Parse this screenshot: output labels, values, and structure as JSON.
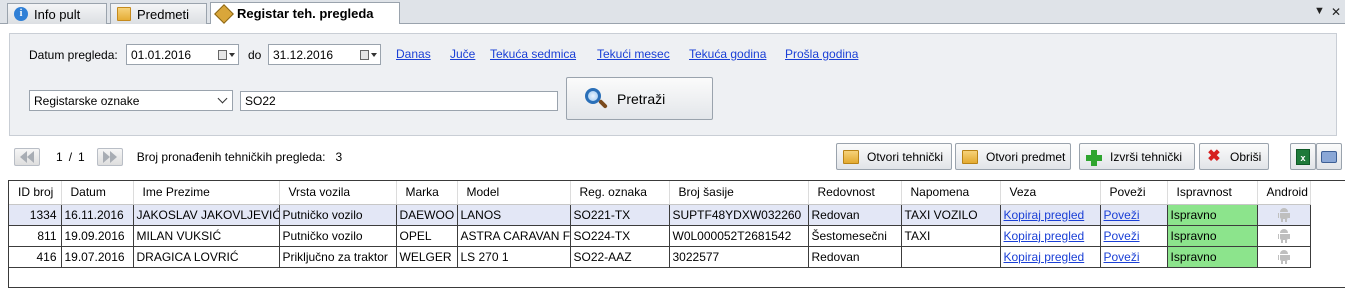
{
  "tabs": [
    {
      "label": "Info pult",
      "icon": "info-icon"
    },
    {
      "label": "Predmeti",
      "icon": "folder-icon"
    },
    {
      "label": "Registar teh. pregleda",
      "icon": "wrench-icon",
      "active": true
    }
  ],
  "filters": {
    "date_label": "Datum pregleda:",
    "date_from": "01.01.2016",
    "to_label": "do",
    "date_to": "31.12.2016",
    "quick_links": [
      "Danas",
      "Juče",
      "Tekuća sedmica",
      "Tekući mesec",
      "Tekuća godina",
      "Prošla godina"
    ],
    "search_field": "Registarske oznake",
    "search_value": "SO22",
    "search_button": "Pretraži"
  },
  "pager": {
    "current": "1",
    "separator": "/",
    "total": "1",
    "count_label": "Broj pronađenih tehničkih pregleda:",
    "count": "3"
  },
  "toolbar": {
    "open_inspection": "Otvori tehnički",
    "open_case": "Otvori predmet",
    "perform_inspection": "Izvrši tehnički",
    "delete": "Obriši",
    "export_icon": "excel-icon",
    "print_icon": "print-icon"
  },
  "table": {
    "columns": [
      "ID broj",
      "Datum",
      "Ime Prezime",
      "Vrsta vozila",
      "Marka",
      "Model",
      "Reg. oznaka",
      "Broj šasije",
      "Redovnost",
      "Napomena",
      "Veza",
      "Poveži",
      "Ispravnost",
      "Android"
    ],
    "rows": [
      [
        "1334",
        "16.11.2016",
        "JAKOSLAV JAKOVLJEVIĆ",
        "Putničko vozilo",
        "DAEWOO",
        "LANOS",
        "SO221-TX",
        "SUPTF48YDXW032260",
        "Redovan",
        "TAXI VOZILO",
        "Kopiraj pregled",
        "Poveži",
        "Ispravno",
        ""
      ],
      [
        "811",
        "19.09.2016",
        "MILAN VUKSIĆ",
        "Putničko vozilo",
        "OPEL",
        "ASTRA CARAVAN F",
        "SO224-TX",
        "W0L000052T2681542",
        "Šestomesečni",
        "TAXI",
        "Kopiraj pregled",
        "Poveži",
        "Ispravno",
        ""
      ],
      [
        "416",
        "19.07.2016",
        "DRAGICA LOVRIĆ",
        "Priključno za traktor",
        "WELGER",
        "LS 270 1",
        "SO22-AAZ",
        "3022577",
        "Redovan",
        "",
        "Kopiraj pregled",
        "Poveži",
        "Ispravno",
        ""
      ]
    ],
    "selected_row": 0
  },
  "colors": {
    "ok_cell": "#8ce48c",
    "selected_row": "#e3e7f6",
    "link": "#1a3fd6"
  }
}
